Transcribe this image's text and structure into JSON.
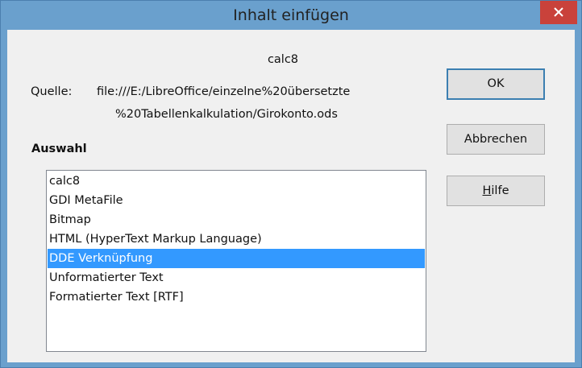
{
  "window": {
    "title": "Inhalt einfügen",
    "close_icon": "close-icon"
  },
  "source": {
    "name": "calc8",
    "label": "Quelle:",
    "path_line1": "file:///E:/LibreOffice/einzelne%20übersetzte",
    "path_line2": "%20Tabellenkalkulation/Girokonto.ods"
  },
  "selection": {
    "label": "Auswahl",
    "items": [
      "calc8",
      "GDI MetaFile",
      "Bitmap",
      "HTML (HyperText Markup Language)",
      "DDE Verknüpfung",
      "Unformatierter Text",
      "Formatierter Text [RTF]"
    ],
    "selected_item": "DDE Verknüpfung"
  },
  "buttons": {
    "ok": "OK",
    "cancel": "Abbrechen",
    "help_accel": "H",
    "help_rest": "ilfe"
  },
  "colors": {
    "titlebar": "#6aa0cd",
    "close_button": "#c9423b",
    "selection_highlight": "#3399ff",
    "dialog_background": "#f0f0f0"
  }
}
